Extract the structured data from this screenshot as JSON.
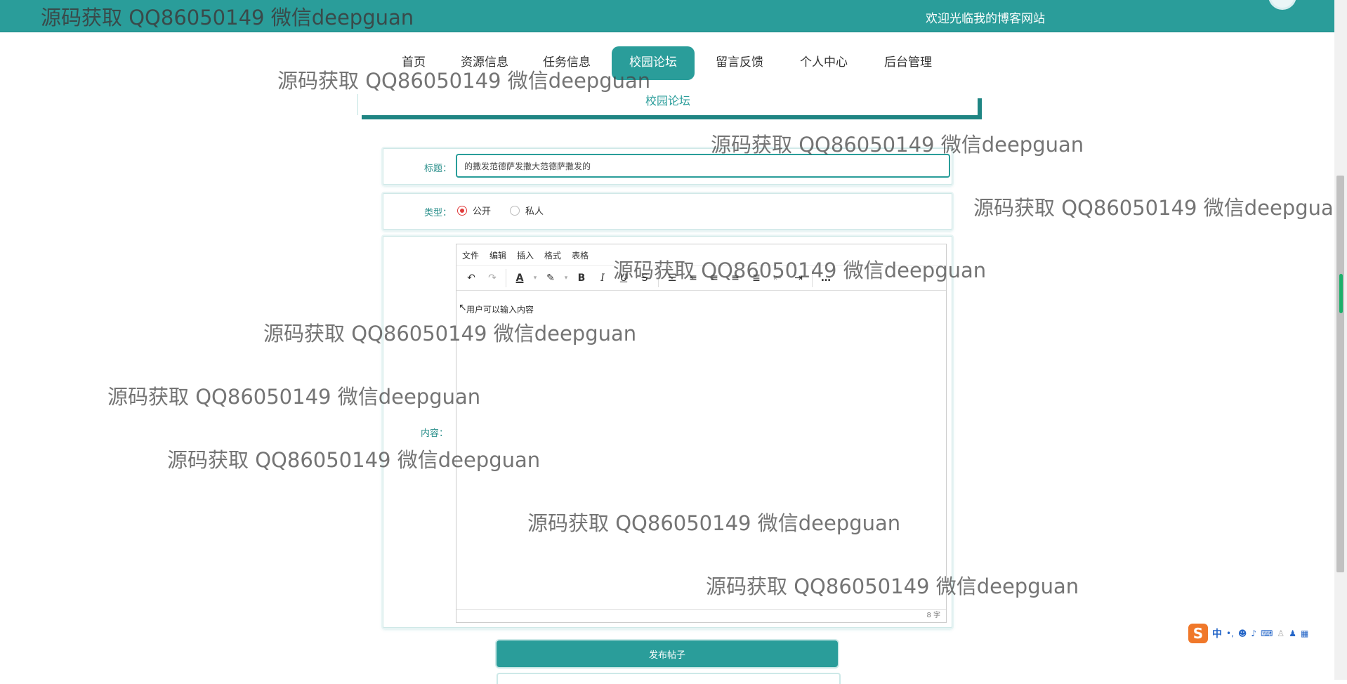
{
  "header": {
    "watermark_top": "源码获取 QQ86050149 微信deepguan",
    "welcome_text": "欢迎光临我的博客网站"
  },
  "nav": {
    "items": [
      {
        "label": "首页"
      },
      {
        "label": "资源信息"
      },
      {
        "label": "任务信息"
      },
      {
        "label": "校园论坛",
        "active": true
      },
      {
        "label": "留言反馈"
      },
      {
        "label": "个人中心"
      },
      {
        "label": "后台管理"
      }
    ]
  },
  "section": {
    "title": "校园论坛"
  },
  "form": {
    "title_label": "标题：",
    "title_value": "的撒发范德萨发撒大范德萨撒发的",
    "type_label": "类型：",
    "type_options": [
      {
        "label": "公开",
        "checked": true
      },
      {
        "label": "私人",
        "checked": false
      }
    ],
    "content_label": "内容：",
    "editor": {
      "menus": [
        "文件",
        "编辑",
        "插入",
        "格式",
        "表格"
      ],
      "toolbar_icons": [
        "undo-icon",
        "redo-icon",
        "text-color-icon",
        "dropdown-icon",
        "highlight-icon",
        "dropdown-icon",
        "bold-icon",
        "italic-icon",
        "underline-icon",
        "strikethrough-icon",
        "bullet-list-icon",
        "align-left-icon",
        "align-center-icon",
        "align-right-icon",
        "justify-icon",
        "outdent-icon",
        "indent-icon",
        "more-icon"
      ],
      "content": "用户可以输入内容",
      "word_count": "8 字"
    },
    "submit_label": "发布帖子"
  },
  "watermarks": [
    "源码获取 QQ86050149 微信deepguan",
    "源码获取 QQ86050149 微信deepguan",
    "源码获取 QQ86050149 微信deepguan",
    "源码获取 QQ86050149 微信deepguan",
    "源码获取 QQ86050149 微信deepguan",
    "源码获取 QQ86050149 微信deepguan",
    "源码获取 QQ86050149 微信deepguan",
    "源码获取 QQ86050149 微信deepguan",
    "源码获取 QQ86050149 微信deepguan"
  ],
  "ime": {
    "logo": "S",
    "mode": "中",
    "icons": [
      "punctuation-icon",
      "emoji-icon",
      "microphone-icon",
      "keyboard-icon",
      "user-icon",
      "shirt-icon",
      "grid-icon"
    ]
  },
  "colors": {
    "accent": "#2a9d9a",
    "radio_checked": "#e03a3a"
  }
}
